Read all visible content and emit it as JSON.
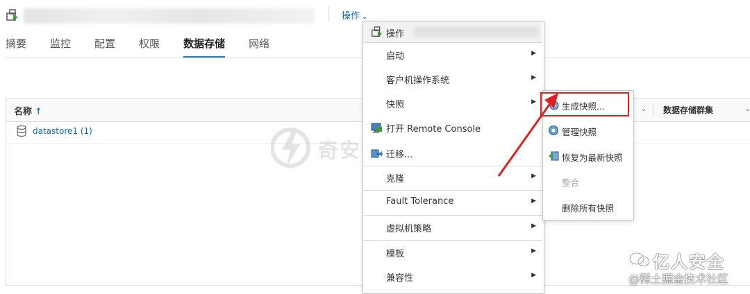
{
  "header": {
    "actions_label": "操作",
    "actions_chevron": "⌄"
  },
  "tabs": [
    {
      "label": "摘要"
    },
    {
      "label": "监控"
    },
    {
      "label": "配置"
    },
    {
      "label": "权限"
    },
    {
      "label": "数据存储",
      "active": true
    },
    {
      "label": "网络"
    }
  ],
  "grid": {
    "col_name": "名称",
    "sort_arrow": "↑",
    "col_cluster": "数据存储群集",
    "rows": [
      {
        "name": "datastore1 (1)"
      }
    ]
  },
  "menu": {
    "header_label": "操作",
    "items": [
      {
        "label": "启动",
        "submenu": true
      },
      {
        "label": "客户机操作系统",
        "submenu": true
      },
      {
        "label": "快照",
        "submenu": true
      },
      {
        "label": "打开 Remote Console",
        "submenu": false,
        "icon": "remote-console-icon"
      },
      {
        "label": "迁移...",
        "submenu": false,
        "icon": "migrate-icon"
      },
      {
        "label": "克隆",
        "submenu": true
      },
      {
        "label": "Fault Tolerance",
        "submenu": true
      },
      {
        "label": "虚拟机策略",
        "submenu": true
      },
      {
        "label": "模板",
        "submenu": true
      },
      {
        "label": "兼容性",
        "submenu": true
      }
    ],
    "arrow_glyph": "▶"
  },
  "snapshot_submenu": {
    "items": [
      {
        "label": "生成快照...",
        "icon": "take-snapshot-icon",
        "enabled": true,
        "highlighted": true
      },
      {
        "label": "管理快照",
        "icon": "manage-snapshots-icon",
        "enabled": true
      },
      {
        "label": "恢复为最新快照",
        "icon": "revert-snapshot-icon",
        "enabled": true
      },
      {
        "label": "整合",
        "enabled": false
      },
      {
        "label": "删除所有快照",
        "enabled": true
      }
    ]
  },
  "watermarks": {
    "center": "奇安信攻防社区",
    "brand": "亿人安全",
    "sub": "@稀土掘金技术社区"
  },
  "colors": {
    "link": "#0b6bbf",
    "tab_active": "#1a7fcf",
    "highlight": "#e02020"
  }
}
